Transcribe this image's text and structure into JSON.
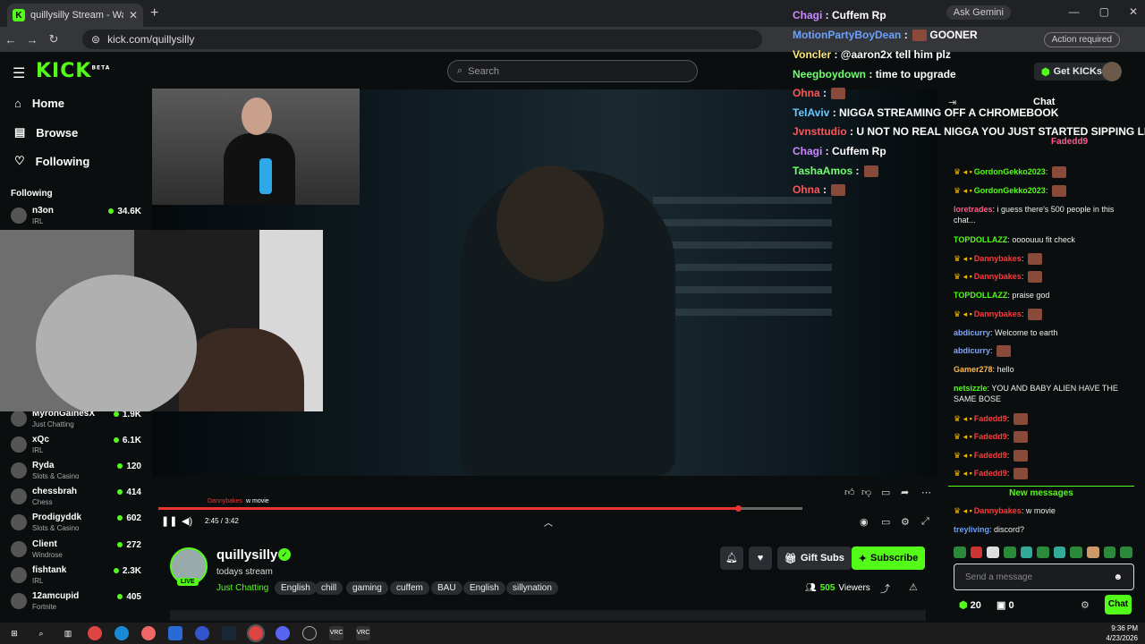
{
  "browser": {
    "tab_title": "quillysilly Stream - Watch L",
    "url": "kick.com/quillysilly",
    "ask_gemini": "Ask Gemini",
    "action_required": "Action required"
  },
  "header": {
    "logo": "KICK",
    "logo_beta": "BETA",
    "search_placeholder": "Search",
    "get_kicks": "Get KICKs"
  },
  "sidebar": {
    "nav": [
      {
        "label": "Home",
        "icon": "home-icon"
      },
      {
        "label": "Browse",
        "icon": "browse-icon"
      },
      {
        "label": "Following",
        "icon": "heart-icon"
      }
    ],
    "following_header": "Following",
    "following": [
      {
        "name": "n3on",
        "category": "IRL",
        "viewers": "34.6K"
      },
      {
        "name": "MyronGainesX",
        "category": "Just Chatting",
        "viewers": "1.9K"
      },
      {
        "name": "xQc",
        "category": "IRL",
        "viewers": "6.1K"
      },
      {
        "name": "Ryda",
        "category": "Slots & Casino",
        "viewers": "120"
      },
      {
        "name": "chessbrah",
        "category": "Chess",
        "viewers": "414"
      },
      {
        "name": "Prodigyddk",
        "category": "Slots & Casino",
        "viewers": "602"
      },
      {
        "name": "Client",
        "category": "Windrose",
        "viewers": "272"
      },
      {
        "name": "fishtank",
        "category": "IRL",
        "viewers": "2.3K"
      },
      {
        "name": "12amcupid",
        "category": "Fortnite",
        "viewers": "405"
      }
    ]
  },
  "player": {
    "caption_user": "Dannybakes",
    "caption_text": "w movie",
    "time": "2:45 / 3:42",
    "progress": 0.9
  },
  "channel": {
    "name": "quillysilly",
    "live": "LIVE",
    "stream_title": "todays stream",
    "category": "Just Chatting",
    "tags": [
      "English",
      "chill",
      "gaming",
      "cuffem",
      "BAU",
      "English",
      "sillynation"
    ],
    "gift_subs": "Gift Subs",
    "subscribe": "Subscribe",
    "viewers_count": "505",
    "viewers_label": "Viewers"
  },
  "overlay_chat": [
    {
      "user": "Chagi",
      "color": "#c98bff",
      "text": "Cuffem Rp",
      "emote": false
    },
    {
      "user": "MotionPartyBoyDean",
      "color": "#6aa0ff",
      "text": "GOONER",
      "emote": true
    },
    {
      "user": "Voncler",
      "color": "#ffe97a",
      "text": "@aaron2x tell him plz",
      "emote": false
    },
    {
      "user": "Neegboydown",
      "color": "#6fff6f",
      "text": "time to upgrade",
      "emote": false
    },
    {
      "user": "Ohna",
      "color": "#ff5555",
      "text": "",
      "emote": true
    },
    {
      "user": "TelAviv",
      "color": "#6ac8ff",
      "text": "NIGGA STREAMING OFF A CHROMEBOOK",
      "emote": false
    },
    {
      "user": "Jvnsttudio",
      "color": "#ff5555",
      "text": "U NOT NO REAL NIGGA YOU JUST STARTED SIPPING LEAN",
      "emote": false
    },
    {
      "user": "Chagi",
      "color": "#c98bff",
      "text": "Cuffem Rp",
      "emote": false
    },
    {
      "user": "TashaAmos",
      "color": "#6fff6f",
      "text": "",
      "emote": true
    },
    {
      "user": "Ohna",
      "color": "#ff5555",
      "text": "",
      "emote": true
    }
  ],
  "chat": {
    "title": "Chat",
    "pinned_user": "Fadedd9",
    "messages": [
      {
        "user": "GordonGekko2023",
        "color": "#53fc18",
        "text": "",
        "badges": true
      },
      {
        "user": "GordonGekko2023",
        "color": "#53fc18",
        "text": "",
        "badges": true
      },
      {
        "user": "loretrades",
        "color": "#ff5c8a",
        "text": "i guess there's 500 people in this chat...",
        "badges": false
      },
      {
        "user": "TOPDOLLAZZ",
        "color": "#53fc18",
        "text": "oooouuu fit check",
        "badges": false
      },
      {
        "user": "Dannybakes",
        "color": "#ff3b3b",
        "text": "",
        "badges": true
      },
      {
        "user": "Dannybakes",
        "color": "#ff3b3b",
        "text": "",
        "badges": true
      },
      {
        "user": "TOPDOLLAZZ",
        "color": "#53fc18",
        "text": "praise god",
        "badges": false
      },
      {
        "user": "Dannybakes",
        "color": "#ff3b3b",
        "text": "",
        "badges": true
      },
      {
        "user": "abdicurry",
        "color": "#7fa8ff",
        "text": "Welcome to earth",
        "badges": false
      },
      {
        "user": "abdicurry",
        "color": "#7fa8ff",
        "text": "",
        "badges": false
      },
      {
        "user": "Gamer278",
        "color": "#ffb84d",
        "text": "hello",
        "badges": false
      },
      {
        "user": "netsizzle",
        "color": "#53fc18",
        "text": "YOU AND BABY ALIEN HAVE THE SAME BOSE",
        "badges": false
      },
      {
        "user": "Fadedd9",
        "color": "#ff3b3b",
        "text": "",
        "badges": true
      },
      {
        "user": "Fadedd9",
        "color": "#ff3b3b",
        "text": "",
        "badges": true
      },
      {
        "user": "Fadedd9",
        "color": "#ff3b3b",
        "text": "",
        "badges": true
      },
      {
        "user": "Fadedd9",
        "color": "#ff3b3b",
        "text": "",
        "badges": true
      }
    ],
    "new_messages": "New messages",
    "after_messages": [
      {
        "user": "Dannybakes",
        "color": "#ff3b3b",
        "text": "w movie",
        "badges": true
      },
      {
        "user": "treyliving",
        "color": "#6aa0ff",
        "text": "discord?",
        "badges": false
      }
    ],
    "input_placeholder": "Send a message",
    "kicks_count": "20",
    "gift_count": "0",
    "chat_button": "Chat"
  },
  "taskbar": {
    "time": "9:36 PM",
    "date": "4/23/2026"
  }
}
